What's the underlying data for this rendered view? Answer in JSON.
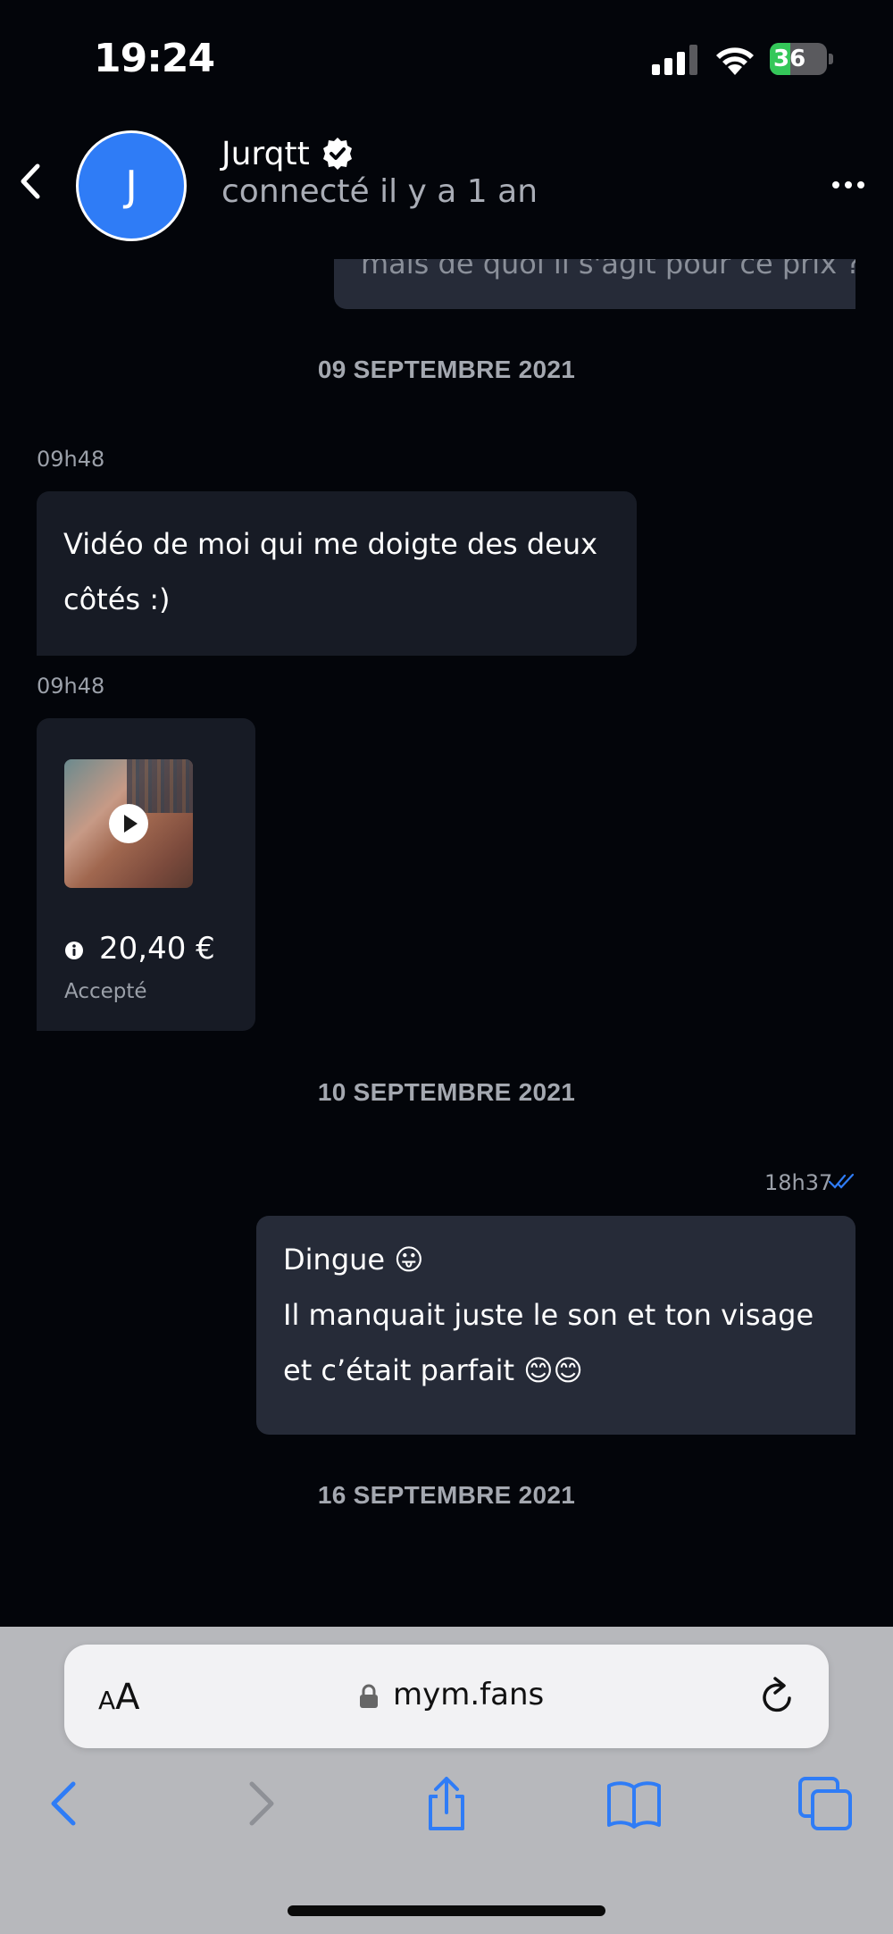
{
  "status_bar": {
    "time": "19:24",
    "battery_level": "36",
    "battery_fraction": 0.36,
    "battery_color": "#34c759"
  },
  "header": {
    "avatar_letter": "J",
    "avatar_color": "#2f7cf6",
    "contact_name": "Jurqtt",
    "last_seen": "connecté il y a 1 an",
    "icons": [
      "back-chevron-icon",
      "verified-badge-icon",
      "more-options-icon"
    ]
  },
  "messages": {
    "partial_top_text": "mais de quoi il s'agit pour ce prix ?",
    "date_1": "09 SEPTEMBRE 2021",
    "msg1_time": "09h48",
    "msg1_text": "Vidéo de moi qui me doigte des deux côtés :)",
    "media_time": "09h48",
    "media_price": "20,40 €",
    "media_status": "Accepté",
    "date_2": "10 SEPTEMBRE 2021",
    "msg2_time": "18h37",
    "msg2_line1": "Dingue 😛",
    "msg2_line2": "Il manquait juste le son et ton visage et c’était parfait 😊😊",
    "date_3": "16 SEPTEMBRE 2021"
  },
  "browser": {
    "text_size_small": "A",
    "text_size_big": "A",
    "url": "mym.fans",
    "toolbar": [
      "back-icon",
      "forward-icon",
      "share-icon",
      "bookmarks-icon",
      "tabs-icon"
    ],
    "accent_color": "#2f7cf6"
  }
}
